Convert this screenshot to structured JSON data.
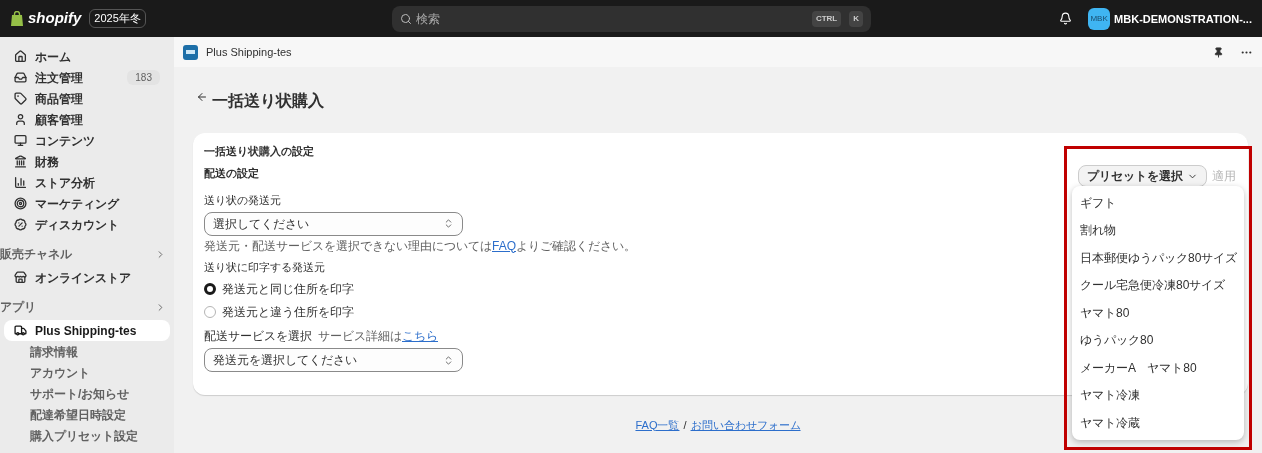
{
  "topbar": {
    "brand": "shopify",
    "edition": "2025年冬",
    "search": {
      "placeholder": "検索",
      "keys": [
        "CTRL",
        "K"
      ]
    },
    "store": {
      "initials": "MBK",
      "name": "MBK-DEMONSTRATION-..."
    }
  },
  "sidebar": {
    "items": [
      {
        "label": "ホーム",
        "kind": "home",
        "selected": false
      },
      {
        "label": "注文管理",
        "kind": "orders",
        "selected": false,
        "count": "183"
      },
      {
        "label": "商品管理",
        "kind": "products",
        "selected": false
      },
      {
        "label": "顧客管理",
        "kind": "customers",
        "selected": false
      },
      {
        "label": "コンテンツ",
        "kind": "content",
        "selected": false
      },
      {
        "label": "財務",
        "kind": "finance",
        "selected": false
      },
      {
        "label": "ストア分析",
        "kind": "analytics",
        "selected": false
      },
      {
        "label": "マーケティング",
        "kind": "marketing",
        "selected": false
      },
      {
        "label": "ディスカウント",
        "kind": "discounts",
        "selected": false
      }
    ],
    "sections": [
      {
        "title": "販売チャネル",
        "items": [
          {
            "label": "オンラインストア",
            "kind": "store",
            "selected": false
          }
        ]
      },
      {
        "title": "アプリ",
        "items": [
          {
            "label": "Plus Shipping-tes",
            "kind": "app",
            "selected": true,
            "children": [
              {
                "label": "請求情報"
              },
              {
                "label": "アカウント"
              },
              {
                "label": "サポート/お知らせ"
              },
              {
                "label": "配達希望日時設定"
              },
              {
                "label": "購入プリセット設定"
              }
            ]
          }
        ]
      }
    ]
  },
  "app_header": {
    "title": "Plus Shipping-tes"
  },
  "page": {
    "title": "一括送り状購入",
    "card": {
      "title": "一括送り状購入の設定",
      "subtitle": "配送の設定",
      "preset": {
        "label": "プリセットを選択",
        "apply": "適用",
        "apply_disabled": true,
        "open": true,
        "highlighted": true,
        "options": [
          "ギフト",
          "割れ物",
          "日本郵便ゆうパック80サイズ",
          "クール宅急便冷凍80サイズ",
          "ヤマト80",
          "ゆうパック80",
          "メーカーA　ヤマト80",
          "ヤマト冷凍",
          "ヤマト冷蔵"
        ]
      },
      "origin": {
        "label": "送り状の発送元",
        "value": "選択してください"
      },
      "help": {
        "before": "発送元・配送サービスを選択できない理由については",
        "link": "FAQ",
        "after": "よりご確認ください。"
      },
      "print_origin": {
        "label": "送り状に印字する発送元",
        "options": [
          {
            "label": "発送元と同じ住所を印字",
            "selected": true
          },
          {
            "label": "発送元と違う住所を印字",
            "selected": false
          }
        ]
      },
      "service": {
        "label": "配送サービスを選択",
        "detail": "サービス詳細は",
        "link": "こちら",
        "value": "発送元を選択してください"
      }
    }
  },
  "footer": {
    "links": [
      "FAQ一覧",
      "お問い合わせフォーム"
    ],
    "separator": "/"
  }
}
